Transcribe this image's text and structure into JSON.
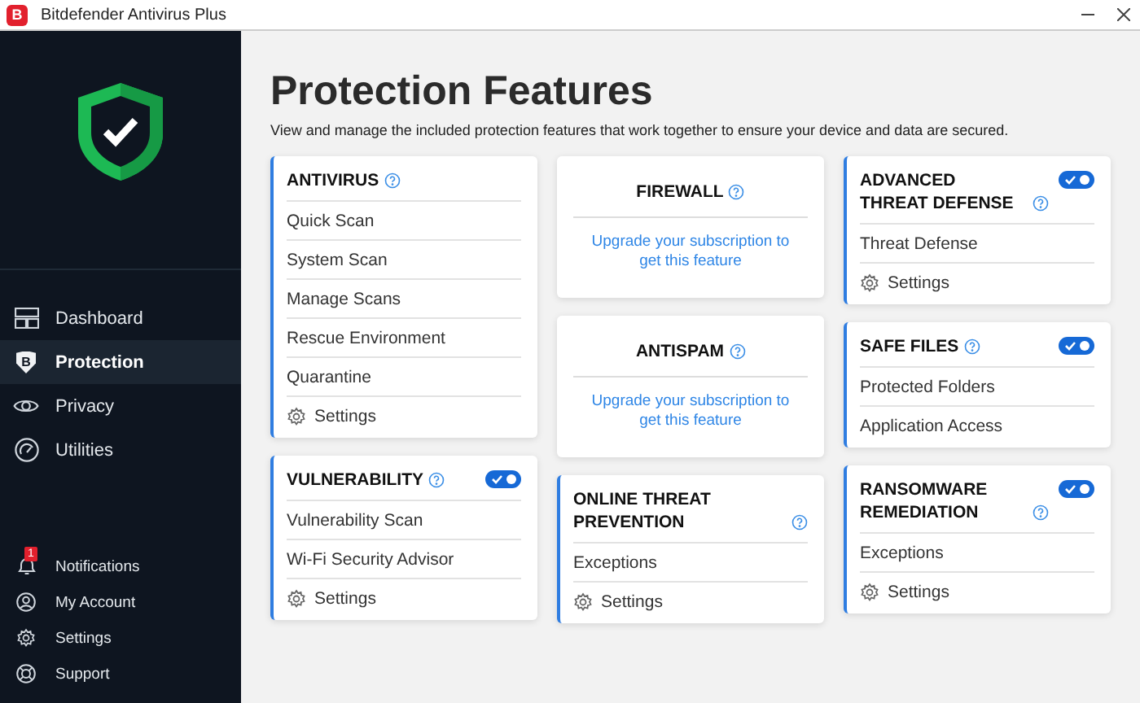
{
  "window": {
    "title": "Bitdefender Antivirus Plus",
    "logo_letter": "B"
  },
  "sidebar": {
    "nav": [
      {
        "label": "Dashboard",
        "selected": false
      },
      {
        "label": "Protection",
        "selected": true,
        "icon_text": "B"
      },
      {
        "label": "Privacy",
        "selected": false
      },
      {
        "label": "Utilities",
        "selected": false
      }
    ],
    "footer": [
      {
        "label": "Notifications",
        "badge": "1"
      },
      {
        "label": "My Account"
      },
      {
        "label": "Settings"
      },
      {
        "label": "Support"
      }
    ]
  },
  "main": {
    "title": "Protection Features",
    "subtitle": "View and manage the included protection features that work together to ensure your device and data are secured."
  },
  "columns": [
    {
      "cards": [
        {
          "kind": "features",
          "title": "ANTIVIRUS",
          "items": [
            {
              "kind": "link",
              "label": "Quick Scan"
            },
            {
              "kind": "link",
              "label": "System Scan"
            },
            {
              "kind": "link",
              "label": "Manage Scans"
            },
            {
              "kind": "link",
              "label": "Rescue Environment"
            },
            {
              "kind": "link",
              "label": "Quarantine"
            },
            {
              "kind": "settings",
              "label": "Settings"
            }
          ]
        },
        {
          "kind": "features",
          "title": "VULNERABILITY",
          "switch_on": true,
          "items": [
            {
              "kind": "link",
              "label": "Vulnerability Scan"
            },
            {
              "kind": "link",
              "label": "Wi-Fi Security Advisor"
            },
            {
              "kind": "settings",
              "label": "Settings"
            }
          ]
        }
      ]
    },
    {
      "cards": [
        {
          "kind": "upgrade",
          "title": "FIREWALL",
          "message": "Upgrade your subscription to get this feature"
        },
        {
          "kind": "upgrade",
          "title": "ANTISPAM",
          "message": "Upgrade your subscription to get this feature"
        },
        {
          "kind": "features",
          "title": "ONLINE THREAT PREVENTION",
          "items": [
            {
              "kind": "link",
              "label": "Exceptions"
            },
            {
              "kind": "settings",
              "label": "Settings"
            }
          ]
        }
      ]
    },
    {
      "cards": [
        {
          "kind": "features",
          "title": "ADVANCED THREAT DEFENSE",
          "switch_on": true,
          "items": [
            {
              "kind": "link",
              "label": "Threat Defense"
            },
            {
              "kind": "settings",
              "label": "Settings"
            }
          ]
        },
        {
          "kind": "features",
          "title": "SAFE FILES",
          "switch_on": true,
          "items": [
            {
              "kind": "link",
              "label": "Protected Folders"
            },
            {
              "kind": "link",
              "label": "Application Access"
            }
          ]
        },
        {
          "kind": "features",
          "title": "RANSOMWARE REMEDIATION",
          "switch_on": true,
          "items": [
            {
              "kind": "link",
              "label": "Exceptions"
            },
            {
              "kind": "settings",
              "label": "Settings"
            }
          ]
        }
      ]
    }
  ]
}
